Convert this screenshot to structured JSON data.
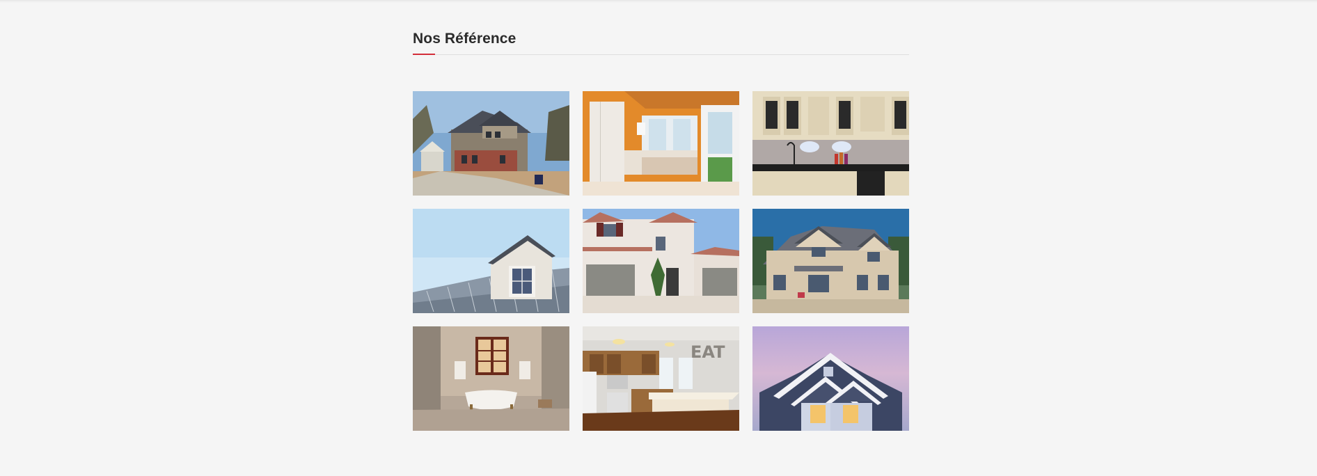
{
  "section": {
    "title": "Nos Référence"
  },
  "colors": {
    "accent": "#d32f3a",
    "background": "#f5f5f5"
  },
  "gallery": {
    "items": [
      {
        "icon": "house-suburban-photo"
      },
      {
        "icon": "kitchen-white-photo"
      },
      {
        "icon": "kitchen-cabinets-photo"
      },
      {
        "icon": "roof-dormer-photo"
      },
      {
        "icon": "stucco-house-photo"
      },
      {
        "icon": "brick-house-photo"
      },
      {
        "icon": "bathroom-tub-photo"
      },
      {
        "icon": "kitchen-eat-photo"
      },
      {
        "icon": "house-dusk-photo"
      }
    ]
  }
}
